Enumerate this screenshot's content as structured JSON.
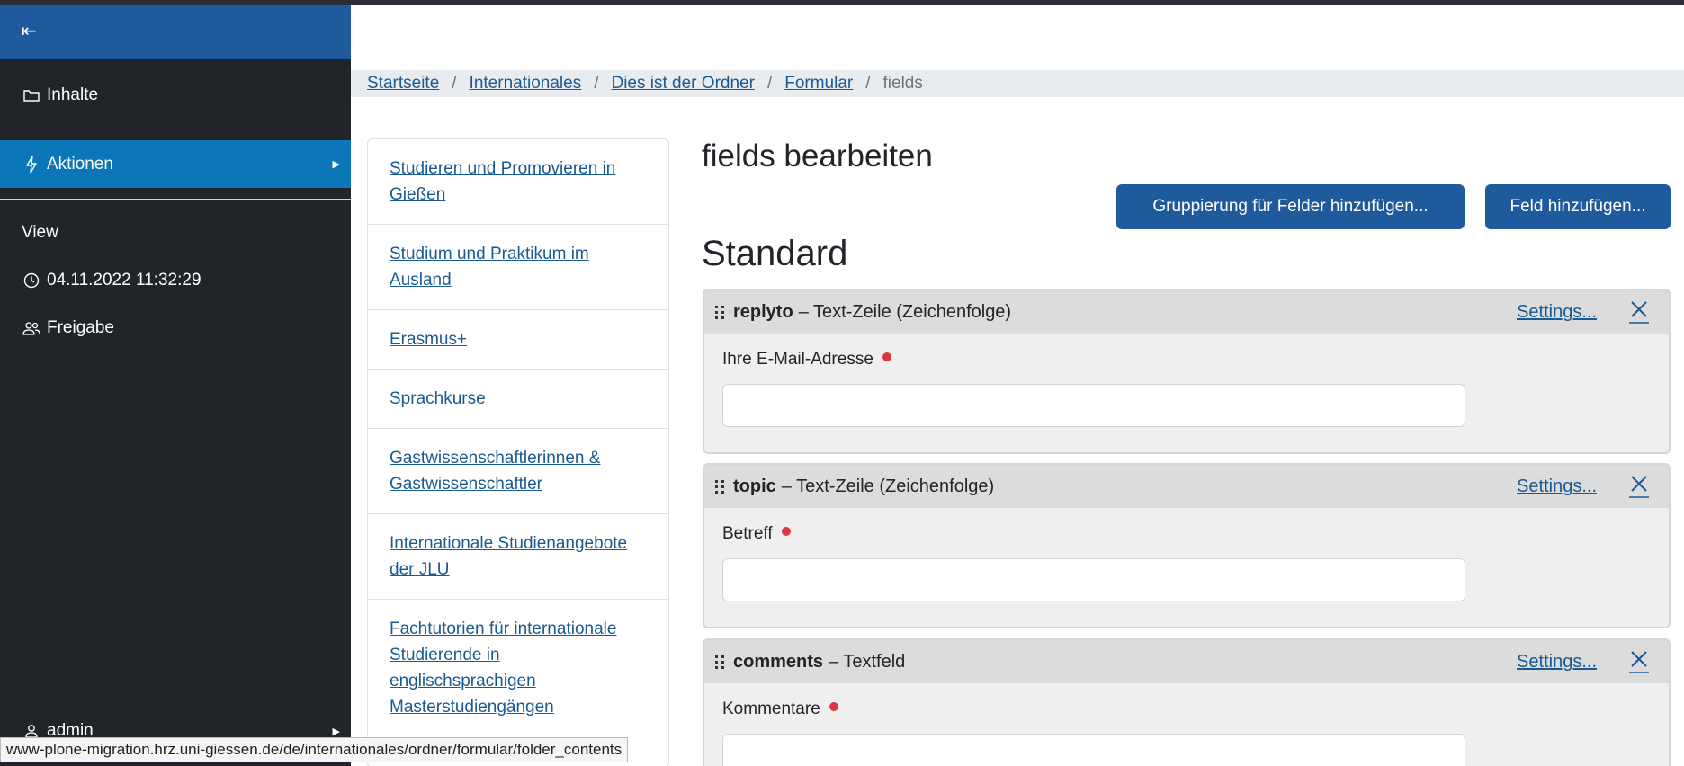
{
  "sidebar": {
    "collapse_icon": "collapse-left-icon",
    "items": [
      {
        "label": "Inhalte",
        "icon": "folder-icon"
      },
      {
        "label": "Aktionen",
        "icon": "lightning-icon"
      },
      {
        "label": "View"
      },
      {
        "label": "04.11.2022 11:32:29",
        "icon": "clock-icon"
      },
      {
        "label": "Freigabe",
        "icon": "people-icon"
      },
      {
        "label": "admin",
        "icon": "user-icon"
      }
    ]
  },
  "breadcrumb": {
    "items": [
      "Startseite",
      "Internationales",
      "Dies ist der Ordner",
      "Formular"
    ],
    "current": "fields",
    "separator": "/"
  },
  "nav": {
    "items": [
      "Studieren und Promovieren in Gießen",
      "Studium und Praktikum im Ausland",
      "Erasmus+",
      "Sprachkurse",
      "Gastwissenschaftlerinnen & Gastwissenschaftler",
      "Internationale Studienangebote der JLU",
      "Fachtutorien für internationale Studierende in englischsprachigen Masterstudiengängen"
    ]
  },
  "content": {
    "title": "fields bearbeiten",
    "add_group_label": "Gruppierung für Felder hinzufügen...",
    "add_field_label": "Feld hinzufügen...",
    "section": "Standard",
    "settings_label": "Settings...",
    "fields": [
      {
        "name": "replyto",
        "type": "– Text-Zeile (Zeichenfolge)",
        "label": "Ihre E-Mail-Adresse"
      },
      {
        "name": "topic",
        "type": "– Text-Zeile (Zeichenfolge)",
        "label": "Betreff"
      },
      {
        "name": "comments",
        "type": "– Textfeld",
        "label": "Kommentare"
      }
    ]
  },
  "statusbar": {
    "url": "www-plone-migration.hrz.uni-giessen.de/de/internationales/ordner/formular/folder_contents"
  },
  "colors": {
    "sidebar_bg": "#212529",
    "primary": "#1f5a9c",
    "active": "#0b76b8",
    "link": "#1a5a93",
    "required": "#dc3545"
  }
}
